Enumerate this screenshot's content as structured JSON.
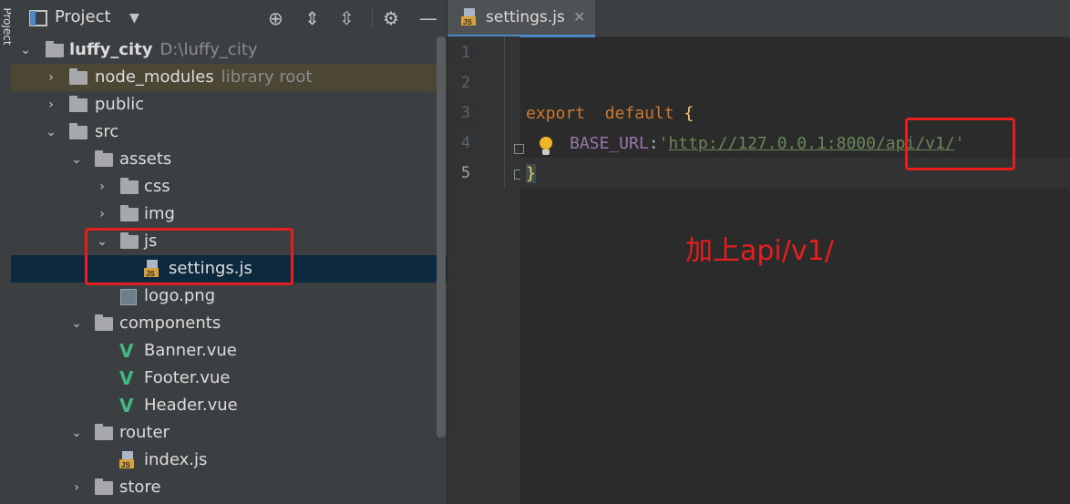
{
  "sidebar_strip": {
    "label": "Project"
  },
  "panel": {
    "title": "Project",
    "icons": [
      "crosshair-icon",
      "expand-all-icon",
      "collapse-all-icon",
      "gear-icon",
      "minimize-icon"
    ]
  },
  "tree": {
    "root": {
      "name": "luffy_city",
      "path": "D:\\luffy_city"
    },
    "node_modules": {
      "name": "node_modules",
      "hint": "library root"
    },
    "public": "public",
    "src": "src",
    "assets": "assets",
    "css": "css",
    "img": "img",
    "js": "js",
    "settings_js": "settings.js",
    "logo_png": "logo.png",
    "components": "components",
    "banner_vue": "Banner.vue",
    "footer_vue": "Footer.vue",
    "header_vue": "Header.vue",
    "router": "router",
    "index_js": "index.js",
    "store": "store"
  },
  "editor": {
    "tab": {
      "label": "settings.js",
      "close": "✕"
    },
    "line_numbers": [
      "1",
      "2",
      "3",
      "4",
      "5"
    ],
    "code": {
      "kw_export": "export",
      "kw_default": "default",
      "open_brace": "{",
      "prop": "BASE_URL",
      "colon": ":",
      "quote": "'",
      "url_base": "http://127.0.0.1:8000",
      "url_path": "/api/v1/",
      "close_brace": "}"
    }
  },
  "annotation": {
    "text": "加上api/v1/",
    "color": "#e61e1e"
  },
  "colors": {
    "selection": "#0d293e",
    "library_highlight": "#4b4734",
    "annotation_red": "#e61e1e",
    "tab_underline": "#4a88c7"
  }
}
